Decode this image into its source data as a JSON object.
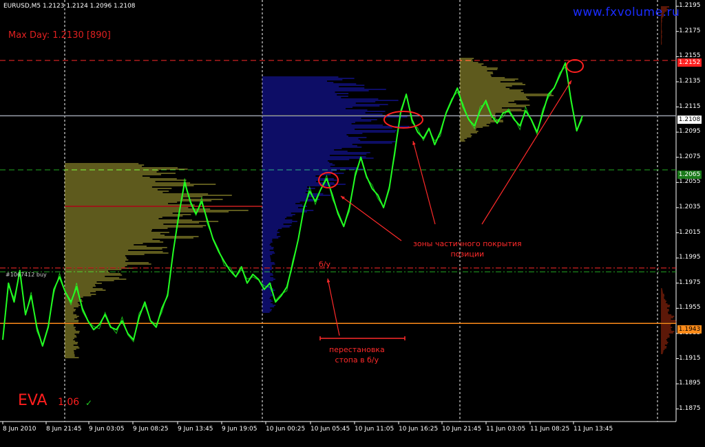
{
  "header": {
    "symbol_info": "EURUSD,M5  1.2123 1.2124 1.2096 1.2108",
    "max_day": "Max Day: 1.2130 [890]",
    "website": "www.fxvolume.ru",
    "order_label": "#1067412 buy"
  },
  "annotations": {
    "breakeven": "б/у",
    "partial_close_line1": "зоны частичного покрытия",
    "partial_close_line2": "позиции",
    "stop_move_line1": "перестановка",
    "stop_move_line2": "стопа в б/у"
  },
  "branding": {
    "name": "EVA",
    "version": "1.06",
    "check": "✓"
  },
  "price_tags": {
    "top_level": "1.2152",
    "current": "1.2108",
    "green_level": "1.2065",
    "stop_level": "1.1943"
  },
  "colors": {
    "background": "#000000",
    "price_line": "#22ff22",
    "profile_blue": "#1a1acc",
    "profile_yellow": "#bdb33a",
    "annotation_red": "#ff2a2a",
    "level_orange": "#ff8c1a",
    "level_green_dash": "#22aa22"
  },
  "chart_data": {
    "type": "line",
    "title": "EURUSD,M5",
    "ylim": [
      1.1865,
      1.22
    ],
    "y_ticks": [
      "1.2195",
      "1.2175",
      "1.2155",
      "1.2135",
      "1.2115",
      "1.2095",
      "1.2075",
      "1.2055",
      "1.2035",
      "1.2015",
      "1.1995",
      "1.1975",
      "1.1955",
      "1.1935",
      "1.1915",
      "1.1895",
      "1.1875"
    ],
    "x_ticks": [
      "8 Jun 2010",
      "8 Jun 21:45",
      "9 Jun 03:05",
      "9 Jun 08:25",
      "9 Jun 13:45",
      "9 Jun 19:05",
      "10 Jun 00:25",
      "10 Jun 05:45",
      "10 Jun 11:05",
      "10 Jun 16:25",
      "10 Jun 21:45",
      "11 Jun 03:05",
      "11 Jun 08:25",
      "11 Jun 13:45"
    ],
    "session_dividers": [
      "8 Jun 21:45",
      "9 Jun 19:05",
      "10 Jun 16:25",
      "11 Jun 13:45"
    ],
    "levels": [
      {
        "price": 1.2152,
        "style": "dashed",
        "color": "#ff2a2a"
      },
      {
        "price": 1.2108,
        "style": "solid",
        "color": "#9aa0aa"
      },
      {
        "price": 1.2065,
        "style": "dashed",
        "color": "#22aa22"
      },
      {
        "price": 1.1987,
        "style": "dash-dot",
        "color": "#ff2a2a"
      },
      {
        "price": 1.1984,
        "style": "dash-dot",
        "color": "#22aa22"
      },
      {
        "price": 1.1943,
        "style": "solid",
        "color": "#ff8c1a"
      }
    ],
    "series": [
      {
        "values": [
          [
            0,
            1.193
          ],
          [
            2,
            1.1975
          ],
          [
            4,
            1.196
          ],
          [
            6,
            1.1985
          ],
          [
            8,
            1.195
          ],
          [
            10,
            1.1965
          ],
          [
            12,
            1.194
          ],
          [
            14,
            1.1925
          ],
          [
            16,
            1.194
          ],
          [
            18,
            1.197
          ],
          [
            20,
            1.198
          ],
          [
            22,
            1.1968
          ],
          [
            24,
            1.196
          ],
          [
            26,
            1.1972
          ],
          [
            28,
            1.1955
          ],
          [
            30,
            1.1945
          ],
          [
            32,
            1.1938
          ],
          [
            34,
            1.1942
          ],
          [
            36,
            1.195
          ],
          [
            38,
            1.194
          ],
          [
            40,
            1.1938
          ],
          [
            42,
            1.1945
          ],
          [
            44,
            1.1935
          ],
          [
            46,
            1.193
          ],
          [
            48,
            1.1948
          ],
          [
            50,
            1.196
          ],
          [
            52,
            1.1945
          ],
          [
            54,
            1.194
          ],
          [
            56,
            1.1955
          ],
          [
            58,
            1.1965
          ],
          [
            60,
            1.2
          ],
          [
            62,
            1.203
          ],
          [
            64,
            1.2055
          ],
          [
            66,
            1.204
          ],
          [
            68,
            1.203
          ],
          [
            70,
            1.204
          ],
          [
            72,
            1.2025
          ],
          [
            74,
            1.201
          ],
          [
            76,
            1.2
          ],
          [
            78,
            1.1992
          ],
          [
            80,
            1.1985
          ],
          [
            82,
            1.198
          ],
          [
            84,
            1.1988
          ],
          [
            86,
            1.1975
          ],
          [
            88,
            1.1982
          ],
          [
            90,
            1.1978
          ],
          [
            92,
            1.197
          ],
          [
            94,
            1.1975
          ],
          [
            96,
            1.196
          ],
          [
            98,
            1.1965
          ],
          [
            100,
            1.1972
          ],
          [
            102,
            1.199
          ],
          [
            104,
            1.201
          ],
          [
            106,
            1.2035
          ],
          [
            108,
            1.2048
          ],
          [
            110,
            1.204
          ],
          [
            112,
            1.205
          ],
          [
            114,
            1.2058
          ],
          [
            116,
            1.2045
          ],
          [
            118,
            1.203
          ],
          [
            120,
            1.202
          ],
          [
            122,
            1.2035
          ],
          [
            124,
            1.206
          ],
          [
            126,
            1.2075
          ],
          [
            128,
            1.206
          ],
          [
            130,
            1.205
          ],
          [
            132,
            1.2045
          ],
          [
            134,
            1.2035
          ],
          [
            136,
            1.205
          ],
          [
            138,
            1.208
          ],
          [
            140,
            1.211
          ],
          [
            142,
            1.2125
          ],
          [
            144,
            1.2105
          ],
          [
            146,
            1.2095
          ],
          [
            148,
            1.209
          ],
          [
            150,
            1.2098
          ],
          [
            152,
            1.2085
          ],
          [
            154,
            1.2095
          ],
          [
            156,
            1.211
          ],
          [
            158,
            1.212
          ],
          [
            160,
            1.213
          ],
          [
            162,
            1.2115
          ],
          [
            164,
            1.2105
          ],
          [
            166,
            1.21
          ],
          [
            168,
            1.2112
          ],
          [
            170,
            1.212
          ],
          [
            172,
            1.2108
          ],
          [
            174,
            1.2102
          ],
          [
            176,
            1.211
          ],
          [
            178,
            1.2112
          ],
          [
            180,
            1.2105
          ],
          [
            182,
            1.21
          ],
          [
            184,
            1.2112
          ],
          [
            186,
            1.2105
          ],
          [
            188,
            1.2095
          ],
          [
            190,
            1.211
          ],
          [
            192,
            1.2125
          ],
          [
            194,
            1.213
          ],
          [
            196,
            1.214
          ],
          [
            198,
            1.215
          ],
          [
            200,
            1.212
          ],
          [
            202,
            1.2096
          ],
          [
            204,
            1.2108
          ]
        ]
      }
    ]
  }
}
